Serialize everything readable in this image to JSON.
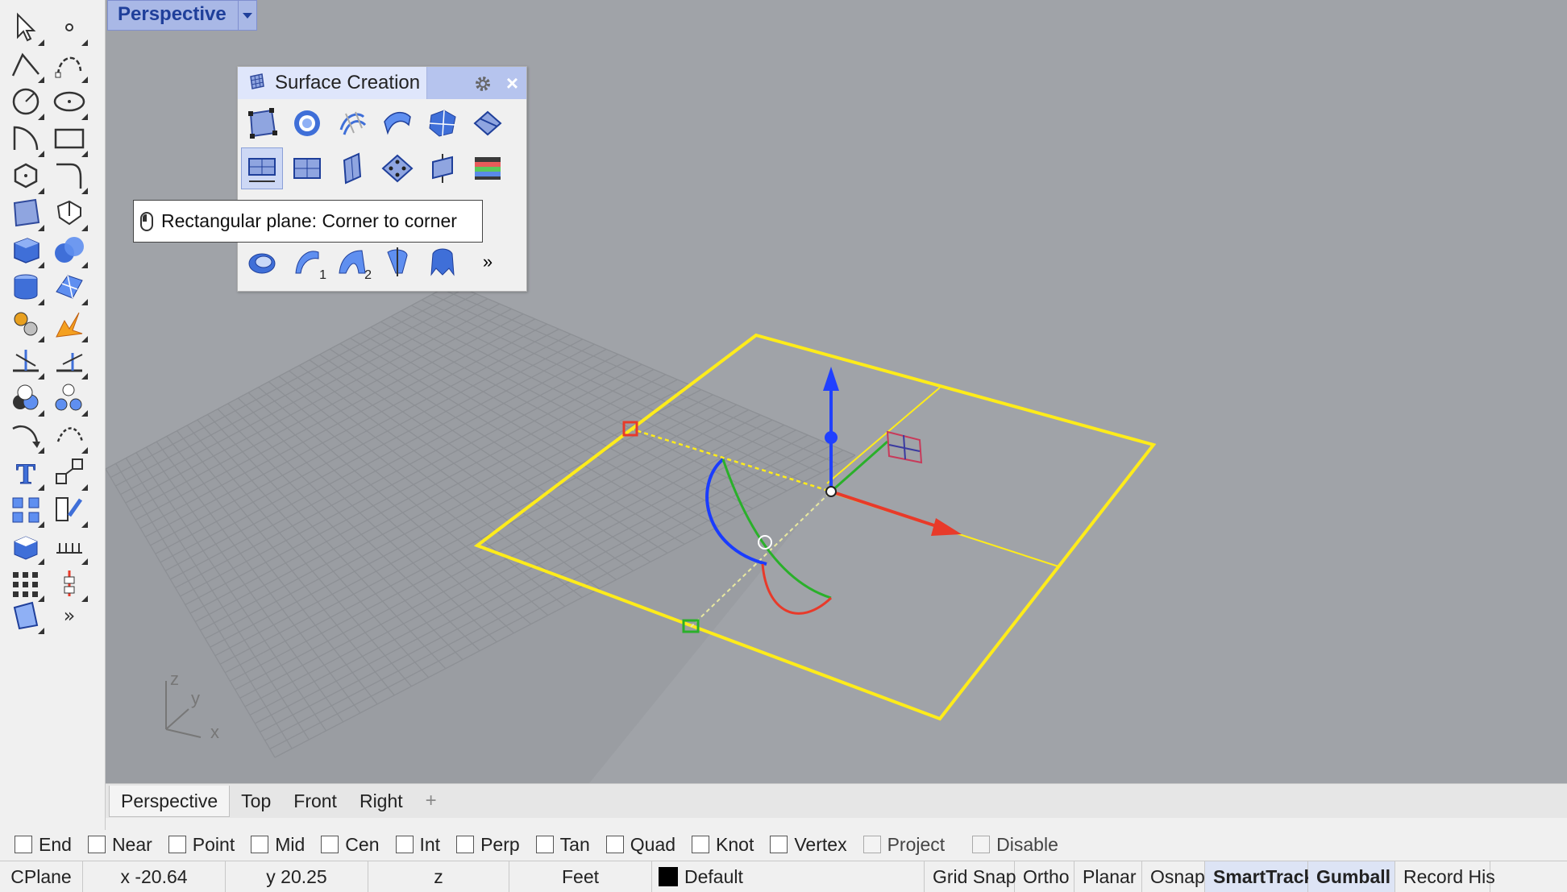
{
  "viewport": {
    "title": "Perspective",
    "dropdown_icon": "chevron-down-icon",
    "axis_labels": {
      "z": "z",
      "y": "y",
      "x": "x"
    },
    "colors": {
      "background": "#a0a3a8",
      "grid": "#8d9095",
      "plane_outline": "#ffec1a",
      "gumball_z": "#2040ff",
      "gumball_x": "#e83a2a",
      "gumball_y": "#2ab02a"
    }
  },
  "left_toolbar": {
    "icons": [
      "select-arrow-icon",
      "point-icon",
      "polyline-icon",
      "curve-icon",
      "circle-icon",
      "ellipse-icon",
      "arc-icon",
      "rectangle-icon",
      "polygon-icon",
      "fillet-curve-icon",
      "surface-from-points-icon",
      "extrude-curve-icon",
      "box-icon",
      "boolean-union-icon",
      "cylinder-icon",
      "mesh-icon",
      "transform-icon",
      "explode-icon",
      "trim-icon",
      "split-icon",
      "group-icon",
      "ungroup-icon",
      "offset-curve-icon",
      "curve-tools-icon",
      "text-icon",
      "scale-icon",
      "array-icon",
      "analyze-icon",
      "render-icon",
      "dimension-icon",
      "grid-array-icon",
      "gumball-icon",
      "drafting-icon",
      "more-icon"
    ],
    "more_label": "»"
  },
  "surface_panel": {
    "title": "Surface Creation",
    "panel_icon": "surface-icon",
    "gear_icon": "gear-icon",
    "close_label": "×",
    "row1": [
      "corner-points-surface-icon",
      "sphere-surface-icon",
      "network-surface-icon",
      "loft-icon",
      "patch-icon",
      "edge-curves-surface-icon"
    ],
    "row2": [
      "rectangular-plane-icon",
      "vertical-plane-icon",
      "plane-3point-icon",
      "plane-through-points-icon",
      "cutting-plane-icon",
      "heightfield-icon"
    ],
    "row4": [
      "revolve-icon",
      "sweep1-icon",
      "sweep2-icon",
      "rail-revolve-icon",
      "extrude-surface-icon"
    ],
    "row4_labels": {
      "sweep1": "1",
      "sweep2": "2"
    },
    "more_label": "»",
    "tooltip": "Rectangular plane: Corner to corner"
  },
  "view_tabs": {
    "tabs": [
      "Perspective",
      "Top",
      "Front",
      "Right"
    ],
    "active": "Perspective",
    "add_icon": "add-tab-icon",
    "add_label": "+"
  },
  "osnaps": {
    "items": [
      {
        "label": "End",
        "checked": false
      },
      {
        "label": "Near",
        "checked": false
      },
      {
        "label": "Point",
        "checked": false
      },
      {
        "label": "Mid",
        "checked": false
      },
      {
        "label": "Cen",
        "checked": false
      },
      {
        "label": "Int",
        "checked": false
      },
      {
        "label": "Perp",
        "checked": false
      },
      {
        "label": "Tan",
        "checked": false
      },
      {
        "label": "Quad",
        "checked": false
      },
      {
        "label": "Knot",
        "checked": false
      },
      {
        "label": "Vertex",
        "checked": false
      },
      {
        "label": "Project",
        "checked": false
      },
      {
        "label": "Disable",
        "checked": false
      }
    ]
  },
  "status_bar": {
    "cplane": "CPlane",
    "x": "x -20.64",
    "y": "y 20.25",
    "z": "z",
    "units": "Feet",
    "layer": "Default",
    "layer_color": "#000000",
    "toggles": [
      {
        "label": "Grid Snap",
        "on": false
      },
      {
        "label": "Ortho",
        "on": false
      },
      {
        "label": "Planar",
        "on": false
      },
      {
        "label": "Osnap",
        "on": false
      },
      {
        "label": "SmartTrack",
        "on": true
      },
      {
        "label": "Gumball",
        "on": true
      },
      {
        "label": "Record His",
        "on": false
      }
    ]
  }
}
